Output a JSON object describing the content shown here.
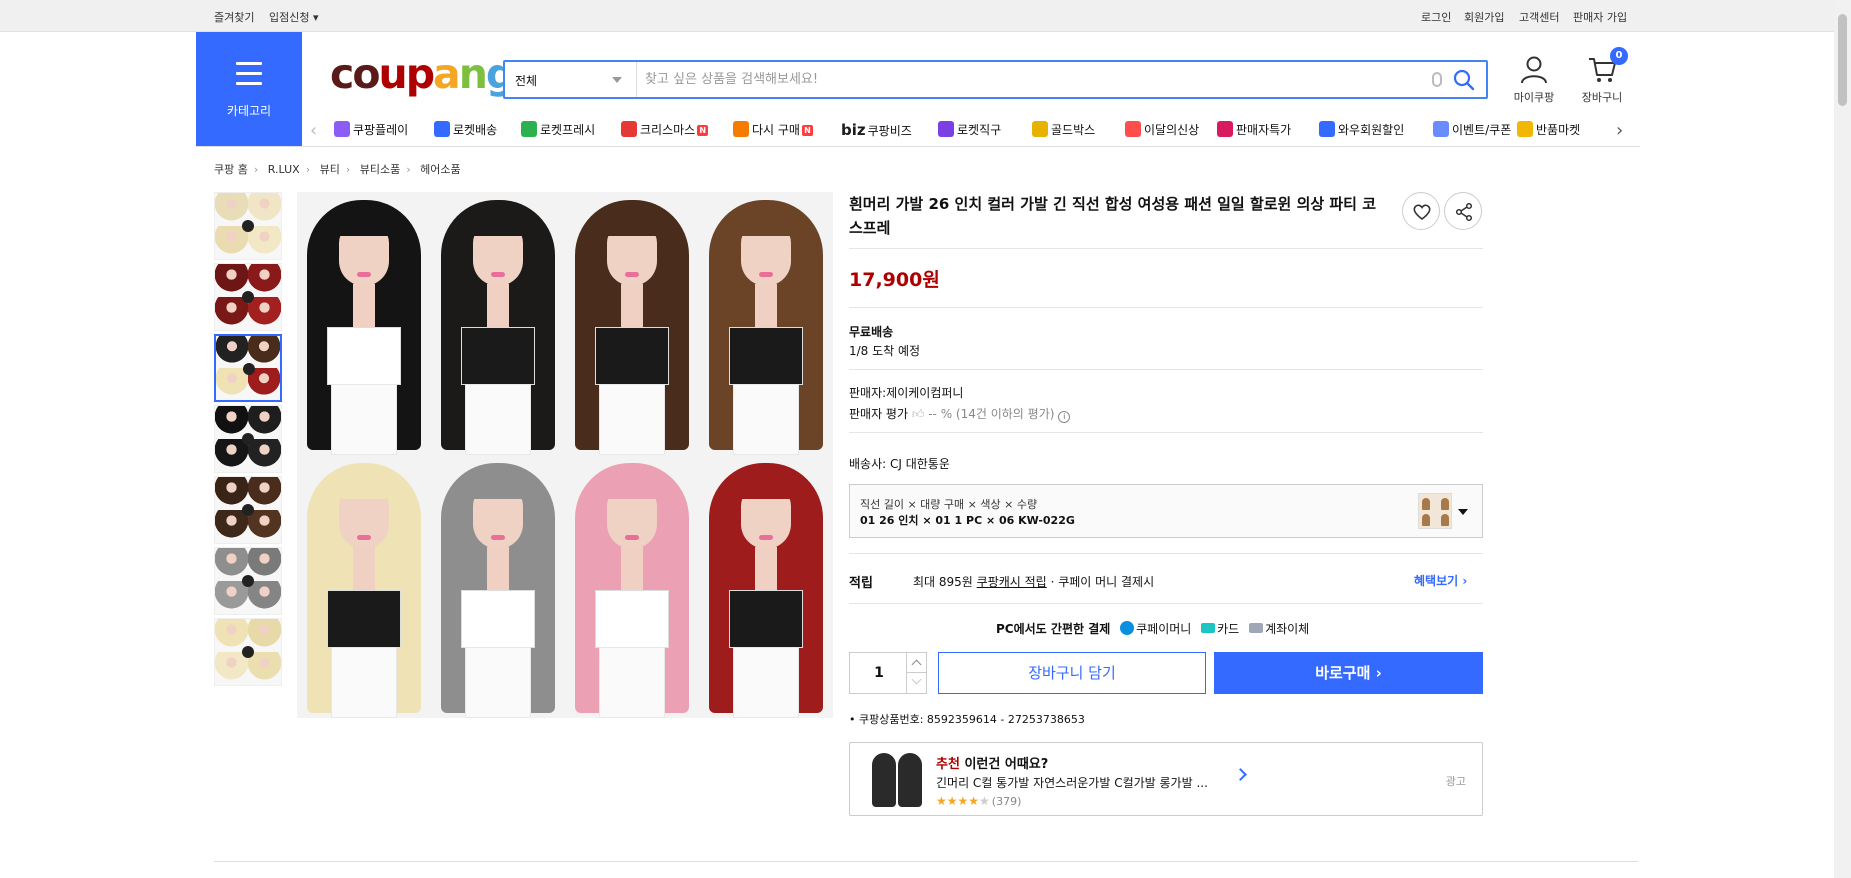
{
  "topbar": {
    "left": [
      "즐겨찾기",
      "입점신청 ▾"
    ],
    "right": [
      "로그인",
      "회원가입",
      "고객센터",
      "판매자 가입"
    ]
  },
  "header": {
    "category_label": "카테고리",
    "logo": {
      "text": "coupang",
      "colors": [
        "#5b1a1a",
        "#ae0000",
        "#f5a623",
        "#7fbf3f",
        "#4aa3df"
      ]
    },
    "search": {
      "scope": "전체",
      "placeholder": "찾고 싶은 상품을 검색해보세요!"
    },
    "mypage_label": "마이쿠팡",
    "cart_label": "장바구니",
    "cart_count": "0",
    "accent": "#346aff"
  },
  "category_nav": {
    "items": [
      {
        "label": "쿠팡플레이",
        "icon": "play-icon",
        "color": "#8b5cf6"
      },
      {
        "label": "로켓배송",
        "icon": "rocket-icon",
        "color": "#346aff"
      },
      {
        "label": "로켓프레시",
        "icon": "rocket-fresh-icon",
        "color": "#2bb24c"
      },
      {
        "label": "크리스마스",
        "icon": "santa-icon",
        "color": "#e53935",
        "new": "N"
      },
      {
        "label": "다시 구매",
        "icon": "home-icon",
        "color": "#f57c00",
        "new": "N"
      },
      {
        "label": "쿠팡비즈",
        "icon": "biz-icon",
        "color": "#1c1c1c",
        "prefix": "biz"
      },
      {
        "label": "로켓직구",
        "icon": "globe-rocket-icon",
        "color": "#7b3fe4"
      },
      {
        "label": "골드박스",
        "icon": "gold-box-icon",
        "color": "#e8b300"
      },
      {
        "label": "이달의신상",
        "icon": "bag-icon",
        "color": "#ff4d4d"
      },
      {
        "label": "판매자특가",
        "icon": "percent-icon",
        "color": "#d81b60"
      },
      {
        "label": "와우회원할인",
        "icon": "wow-icon",
        "color": "#346aff"
      },
      {
        "label": "이벤트/쿠폰",
        "icon": "coupon-icon",
        "color": "#6a8cff"
      },
      {
        "label": "반품마켓",
        "icon": "market-icon",
        "color": "#f2b705"
      }
    ]
  },
  "breadcrumb": [
    "쿠팡 홈",
    "R.LUX",
    "뷰티",
    "뷰티소품",
    "헤어소품"
  ],
  "gallery": {
    "main_colors": [
      "#141414",
      "#1c1a18",
      "#4a2c1c",
      "#6b4428",
      "#efe2b4",
      "#8e8e8e",
      "#eba0b4",
      "#9e1c1c"
    ],
    "main_tops": [
      "#ffffff",
      "#1a1a1a",
      "#1a1a1a",
      "#1a1a1a",
      "#1a1a1a",
      "#ffffff",
      "#ffffff",
      "#1a1a1a"
    ],
    "thumbnails": [
      {
        "colors": [
          "#e8ddb6",
          "#f0e6c6",
          "#eadcb0",
          "#f3e8c5"
        ],
        "active": false
      },
      {
        "colors": [
          "#6e1616",
          "#8a1a1a",
          "#7a1818",
          "#a32020"
        ],
        "active": false
      },
      {
        "colors": [
          "#222",
          "#4a2c1c",
          "#efe2b4",
          "#9e1c1c"
        ],
        "active": true
      },
      {
        "colors": [
          "#111",
          "#1e1e1e",
          "#161616",
          "#222"
        ],
        "active": false
      },
      {
        "colors": [
          "#3a2418",
          "#4a2c1c",
          "#3e281a",
          "#523420"
        ],
        "active": false
      },
      {
        "colors": [
          "#8e8e8e",
          "#7a7a7a",
          "#9a9a9a",
          "#858585"
        ],
        "active": false
      },
      {
        "colors": [
          "#efe2b4",
          "#e8d9a8",
          "#f3e8c5",
          "#ebdfb0"
        ],
        "active": false
      }
    ]
  },
  "product": {
    "title": "흰머리 가발 26 인치 컬러 가발 긴 직선 합성 여성용 패션 일일 할로윈 의상 파티 코스프레",
    "price": "17,900원",
    "shipping_title": "무료배송",
    "arrival": "1/8 도착 예정",
    "seller": "판매자:제이케이컴퍼니",
    "seller_rating_label": "판매자 평가",
    "seller_rating_value": "-- % (14건 이하의 평가)",
    "carrier": "배송사:  CJ 대한통운",
    "option_line1": "직선 길이 × 대량 구매 × 색상 × 수량",
    "option_line2": "01 26 인치 × 01 1 PC × 06 KW-022G",
    "reward_label": "적립",
    "reward_prefix": "최대 895원",
    "reward_link": "쿠팡캐시 적립",
    "reward_suffix": "· 쿠페이 머니 결제시",
    "benefit_link": "혜택보기 ›",
    "pay_title": "PC에서도 간편한 결제",
    "pay_options": [
      {
        "label": "쿠페이머니",
        "color": "#0a8fe0"
      },
      {
        "label": "카드",
        "color": "#1ec5c5"
      },
      {
        "label": "계좌이체",
        "color": "#a0a8b8"
      }
    ],
    "quantity": "1",
    "cart_button": "장바구니 담기",
    "buy_button": "바로구매 ›",
    "product_number": "쿠팡상품번호: 8592359614 - 27253738653"
  },
  "recommend": {
    "title_red": "추천",
    "title": " 이런건 어때요?",
    "item": "긴머리 C컬 통가발 자연스러운가발 C컬가발 롱가발 ...",
    "stars_full": "★★★★",
    "stars_empty": "★",
    "review_count": "(379)",
    "ad_label": "광고"
  }
}
